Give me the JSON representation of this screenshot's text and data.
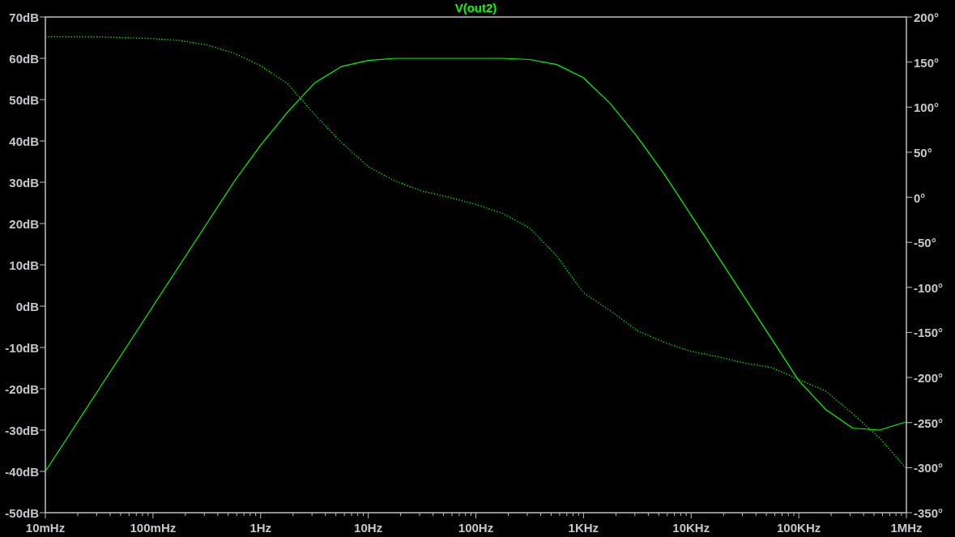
{
  "plot": {
    "magnitude": {
      "chart_data": {
        "type": "line",
        "categories": [
          "10mHz",
          null,
          null,
          null,
          "100mHz",
          null,
          null,
          null,
          "1Hz",
          null,
          null,
          null,
          "10Hz",
          null,
          null,
          null,
          "100Hz",
          null,
          null,
          null,
          "1KHz",
          null,
          null,
          null,
          "10KHz",
          null,
          null,
          null,
          "100KHz",
          null,
          null,
          null,
          "1MHz"
        ],
        "series": [
          {
            "name": "V(out2)",
            "color": "#00ff00",
            "line_style": "solid",
            "values": [
              -40,
              -30,
              -20,
              -10,
              0,
              10,
              20,
              30,
              39,
              47,
              54,
              58,
              59.5,
              60,
              60,
              60,
              60,
              60,
              59.7,
              58.5,
              55.3,
              49,
              41,
              32,
              22,
              12,
              2,
              -8,
              -18,
              -25,
              -29.5,
              -30,
              -28
            ]
          }
        ],
        "ylim": [
          -50,
          70
        ],
        "yticks": [
          {
            "value": 70,
            "label": "70dB"
          },
          {
            "value": 60,
            "label": "60dB"
          },
          {
            "value": 50,
            "label": "50dB"
          },
          {
            "value": 40,
            "label": "40dB"
          },
          {
            "value": 30,
            "label": "30dB"
          },
          {
            "value": 20,
            "label": "20dB"
          },
          {
            "value": 10,
            "label": "10dB"
          },
          {
            "value": 0,
            "label": "0dB"
          },
          {
            "value": -10,
            "label": "-10dB"
          },
          {
            "value": -20,
            "label": "-20dB"
          },
          {
            "value": -30,
            "label": "-30dB"
          },
          {
            "value": -40,
            "label": "-40dB"
          },
          {
            "value": -50,
            "label": "-50dB"
          }
        ]
      }
    },
    "phase": {
      "chart_data": {
        "type": "line",
        "categories": [
          null,
          null,
          null,
          null,
          null,
          null,
          null,
          null,
          null,
          null,
          null,
          null,
          null,
          null,
          null,
          null,
          null,
          null,
          null,
          null,
          null,
          null,
          null,
          null,
          null,
          null,
          null,
          null,
          null,
          null,
          null,
          null,
          null
        ],
        "series": [
          {
            "color": "#00ff00",
            "line_style": "dotted",
            "values": [
              178,
              178,
              178,
              177,
              176,
              174,
              169,
              160,
              146,
              126,
              92,
              61,
              34,
              18,
              7,
              0,
              -8,
              -18,
              -34,
              -65,
              -106,
              -126,
              -148,
              -161,
              -171,
              -177,
              -184,
              -189,
              -202,
              -215,
              -240,
              -267,
              -301
            ]
          }
        ],
        "ylim": [
          -350,
          200
        ],
        "yticks": [
          {
            "value": 200,
            "label": "200°"
          },
          {
            "value": 150,
            "label": "150°"
          },
          {
            "value": 100,
            "label": "100°"
          },
          {
            "value": 50,
            "label": "50°"
          },
          {
            "value": 0,
            "label": "0°"
          },
          {
            "value": -50,
            "label": "-50°"
          },
          {
            "value": -100,
            "label": "-100°"
          },
          {
            "value": -150,
            "label": "-150°"
          },
          {
            "value": -200,
            "label": "-200°"
          },
          {
            "value": -250,
            "label": "-250°"
          },
          {
            "value": -300,
            "label": "-300°"
          },
          {
            "value": -350,
            "label": "-350°"
          }
        ]
      }
    }
  }
}
